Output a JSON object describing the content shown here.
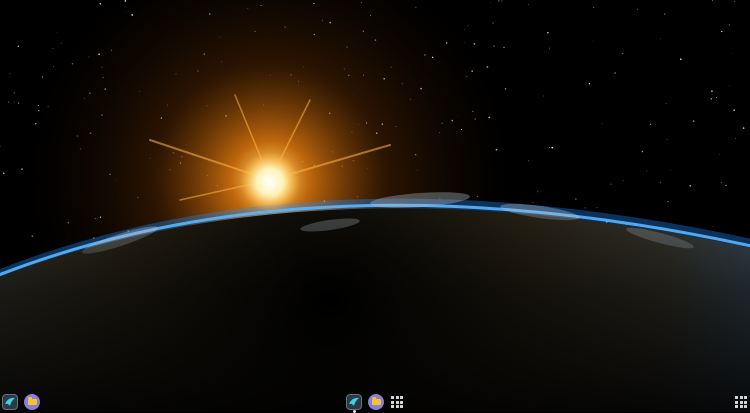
{
  "wallpaper": {
    "description_icon": "earth-sunrise-wallpaper",
    "colors": {
      "space": "#000000",
      "sun": "#ffe08a",
      "glow": "#ff9a1a",
      "atmosphere": "#1e8bff"
    }
  },
  "dock": {
    "left": [
      {
        "name": "browser-app-icon",
        "icon": "browser-icon"
      },
      {
        "name": "files-app-icon",
        "icon": "files-icon"
      }
    ],
    "center": [
      {
        "name": "browser-app-icon",
        "icon": "browser-icon"
      },
      {
        "name": "files-app-icon",
        "icon": "files-icon"
      },
      {
        "name": "app-launcher-icon",
        "icon": "grid-icon"
      }
    ],
    "right": [
      {
        "name": "app-launcher-icon",
        "icon": "grid-icon"
      }
    ]
  }
}
